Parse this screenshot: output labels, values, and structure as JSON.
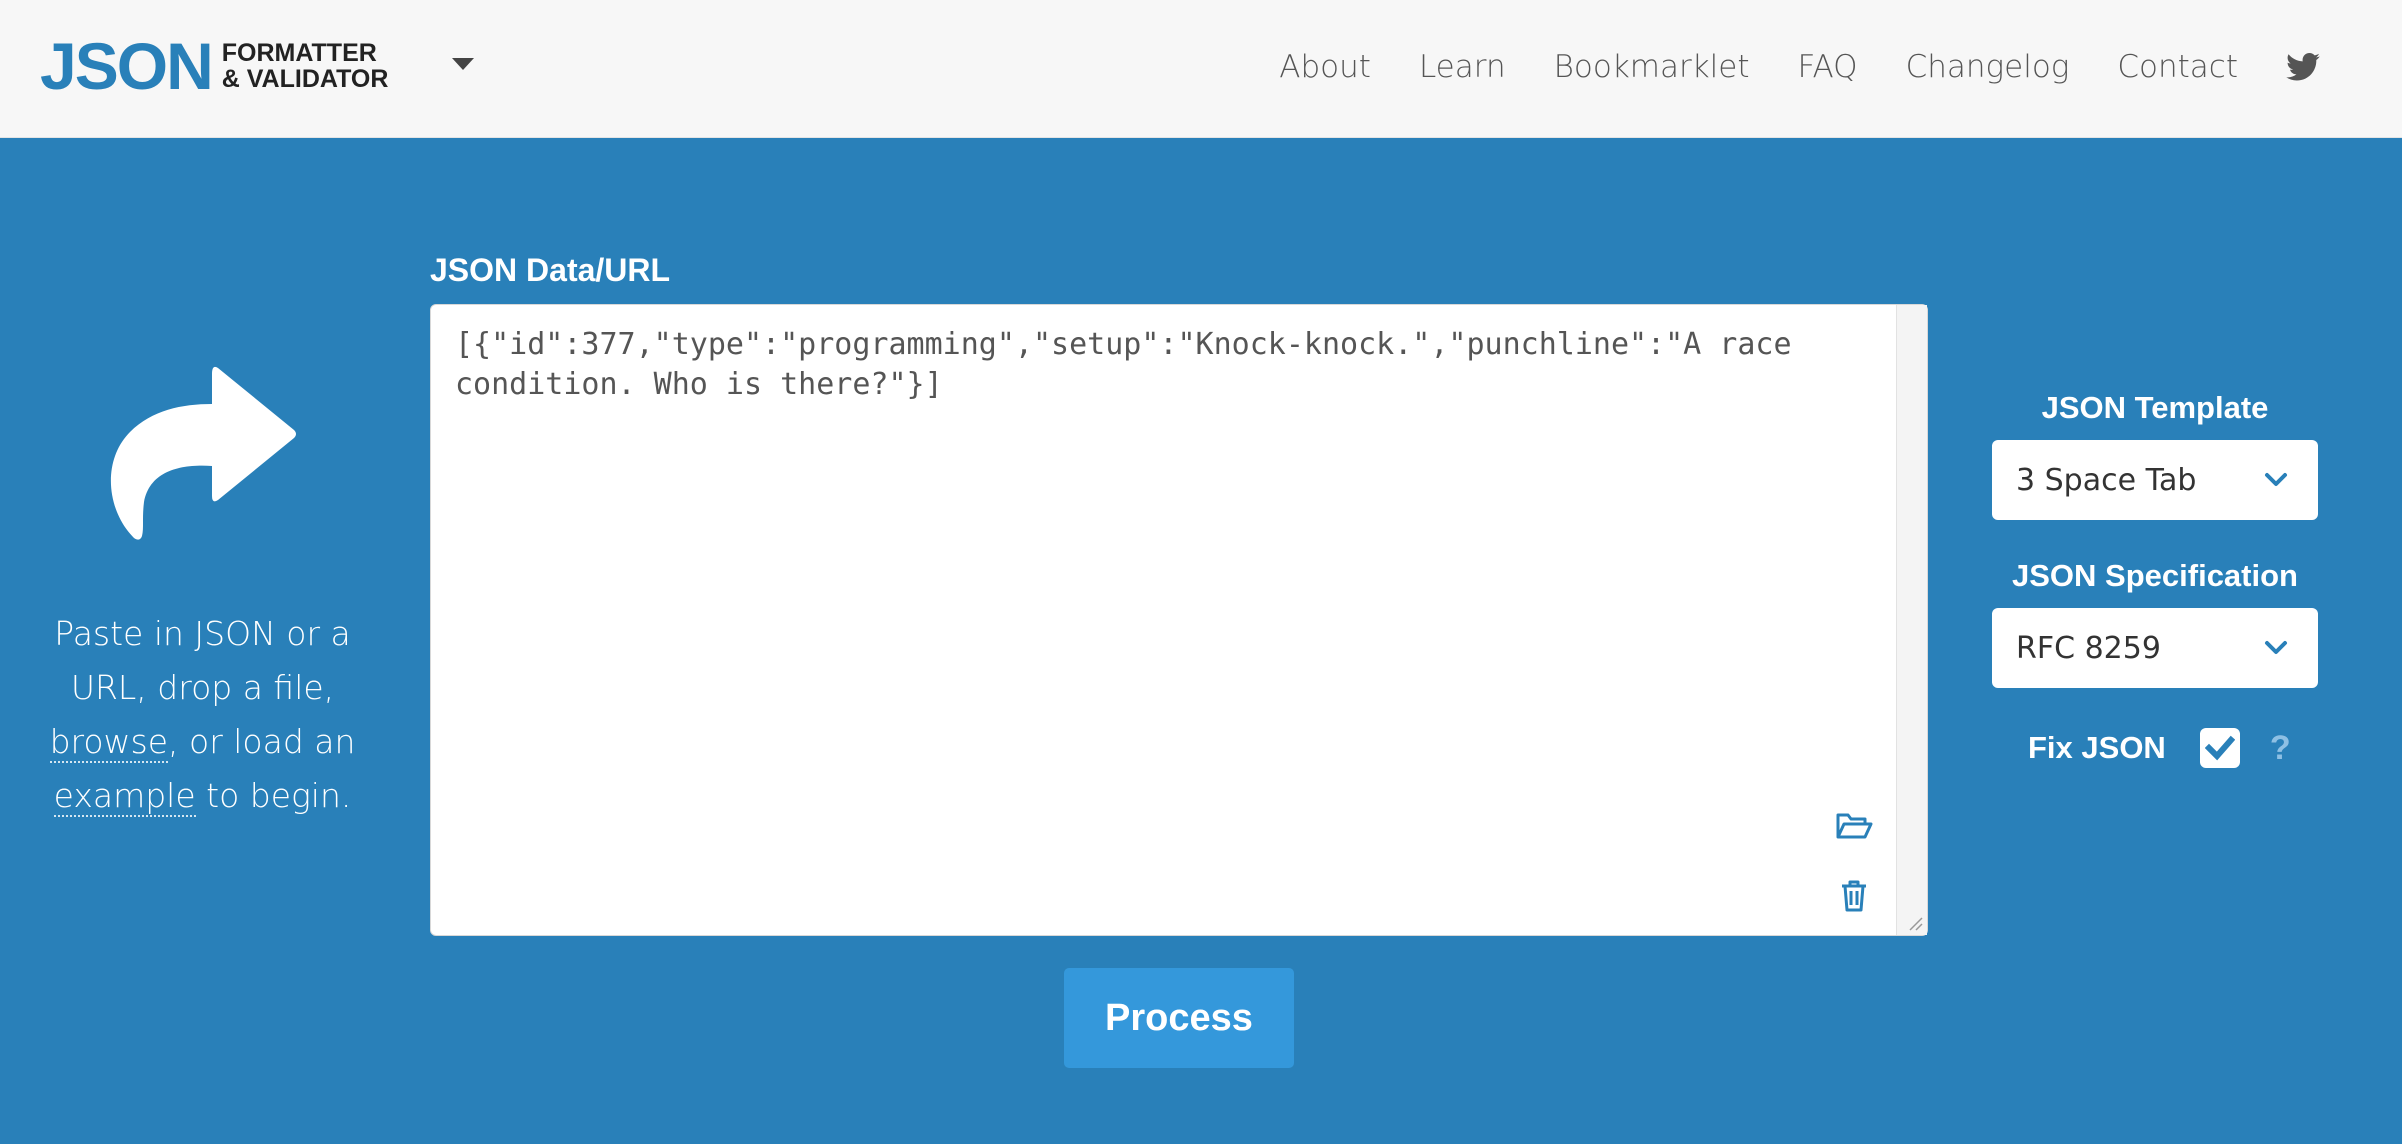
{
  "header": {
    "logo_main": "JSON",
    "logo_line1": "FORMATTER",
    "logo_line2": "& VALIDATOR",
    "nav": [
      "About",
      "Learn",
      "Bookmarklet",
      "FAQ",
      "Changelog",
      "Contact"
    ],
    "social_icon": "twitter-icon"
  },
  "hint": {
    "line1": "Paste in JSON or a URL, drop a file,",
    "browse_link": "browse",
    "mid": ", or load an",
    "example_link": "example",
    "end": " to begin."
  },
  "editor": {
    "label": "JSON Data/URL",
    "value": "[{\"id\":377,\"type\":\"programming\",\"setup\":\"Knock-knock.\",\"punchline\":\"A race condition. Who is there?\"}]",
    "icons": [
      "folder-open-icon",
      "trash-icon"
    ]
  },
  "process_label": "Process",
  "options": {
    "template_label": "JSON Template",
    "template_value": "3 Space Tab",
    "spec_label": "JSON Specification",
    "spec_value": "RFC 8259",
    "fix_label": "Fix JSON",
    "fix_checked": true,
    "help_glyph": "?"
  },
  "colors": {
    "brand": "#2980b9",
    "button": "#3498db",
    "header_bg": "#f7f7f7"
  }
}
